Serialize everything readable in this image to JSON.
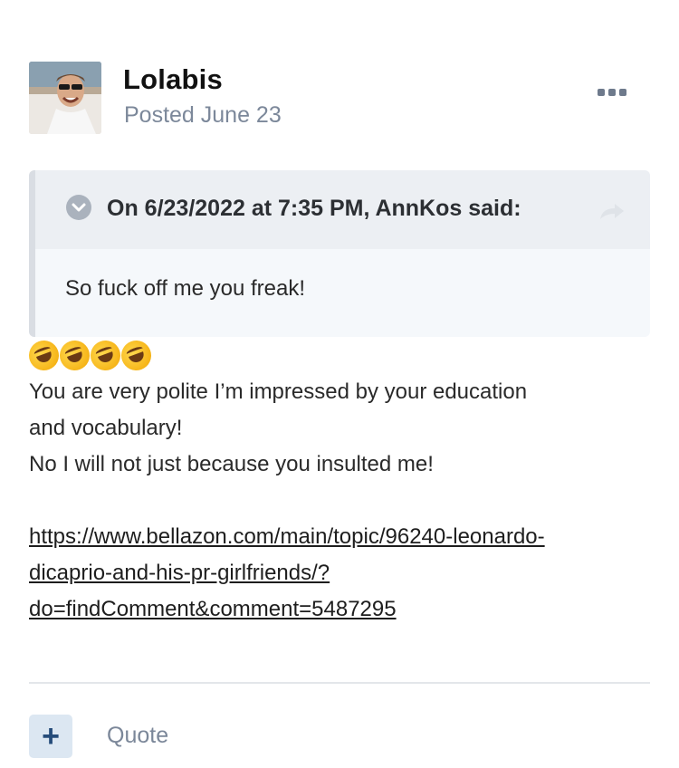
{
  "post": {
    "author": "Lolabis",
    "posted": "Posted June 23",
    "avatar_icon": "user-photo-avatar",
    "more_icon": "ellipsis-icon"
  },
  "quote": {
    "header": "On 6/23/2022 at 7:35 PM, AnnKos said:",
    "text": "So fuck off me you freak!",
    "chevron_icon": "chevron-down-icon",
    "share_icon": "share-arrow-icon"
  },
  "body": {
    "emojis": "🤣🤣🤣🤣",
    "line1": "You are very polite I’m impressed by your education",
    "line2": "and vocabulary!",
    "line3": "No I will not just because you insulted me!",
    "link_line1": "https://www.bellazon.com/main/topic/96240-leonardo-",
    "link_line2": "dicaprio-and-his-pr-girlfriends/?",
    "link_line3": "do=findComment&comment=5487295"
  },
  "footer": {
    "plus_label": "+",
    "quote_label": "Quote"
  },
  "colors": {
    "muted_text": "#7c889a",
    "quote_bg": "#f5f8fb",
    "quote_header_bg": "#eceff3",
    "plus_button_bg": "#dce7f2"
  }
}
